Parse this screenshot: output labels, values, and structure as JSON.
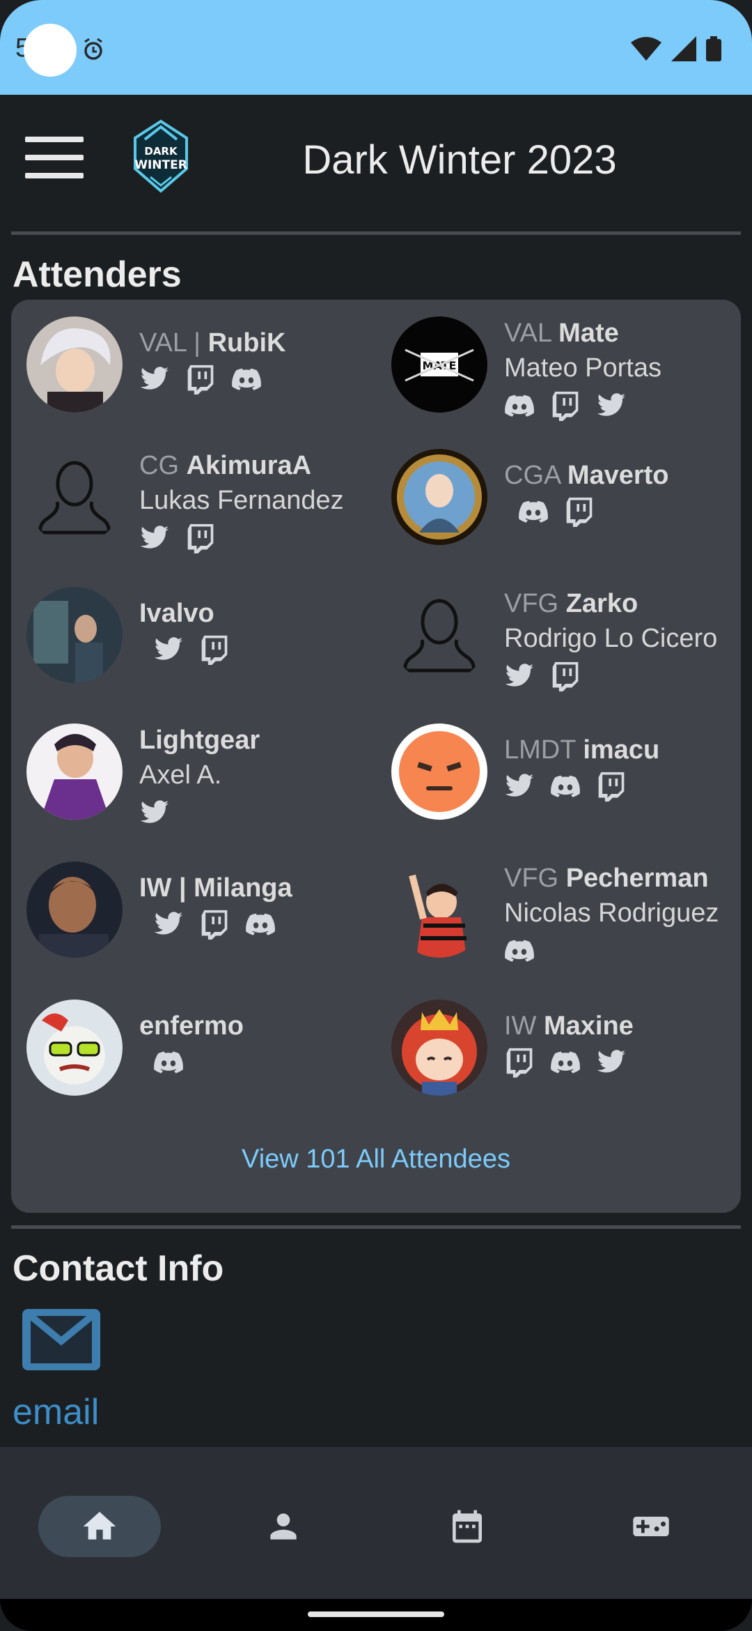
{
  "status_bar": {
    "time_fragment": "5"
  },
  "app_bar": {
    "title": "Dark Winter 2023",
    "logo_text": "DARK WINTER"
  },
  "attenders": {
    "title": "Attenders",
    "view_all": "View 101 All Attendees",
    "items": [
      {
        "prefix": "VAL | ",
        "nick": "RubiK",
        "real": "",
        "socials": [
          "twitter",
          "twitch",
          "discord"
        ]
      },
      {
        "prefix": "VAL ",
        "nick": "Mate",
        "real": "Mateo Portas",
        "socials": [
          "discord",
          "twitch",
          "twitter"
        ]
      },
      {
        "prefix": "CG ",
        "nick": "AkimuraA",
        "real": "Lukas Fernandez",
        "socials": [
          "twitter",
          "twitch"
        ]
      },
      {
        "prefix": "CGA ",
        "nick": "Maverto",
        "real": "",
        "socials": [
          "discord",
          "twitch"
        ]
      },
      {
        "prefix": "",
        "nick": "Ivalvo",
        "real": "",
        "socials": [
          "twitter",
          "twitch"
        ]
      },
      {
        "prefix": "VFG ",
        "nick": "Zarko",
        "real": "Rodrigo Lo Cicero",
        "socials": [
          "twitter",
          "twitch"
        ]
      },
      {
        "prefix": "",
        "nick": "Lightgear",
        "real": "Axel A.",
        "socials": [
          "twitter"
        ]
      },
      {
        "prefix": "LMDT ",
        "nick": "imacu",
        "real": "",
        "socials": [
          "twitter",
          "discord",
          "twitch"
        ]
      },
      {
        "prefix": "",
        "nick": "IW | Milanga",
        "real": "",
        "socials": [
          "twitter",
          "twitch",
          "discord"
        ]
      },
      {
        "prefix": "VFG ",
        "nick": "Pecherman",
        "real": "Nicolas Rodriguez",
        "socials": [
          "discord"
        ]
      },
      {
        "prefix": "",
        "nick": "enfermo",
        "real": "",
        "socials": [
          "discord"
        ]
      },
      {
        "prefix": "IW ",
        "nick": "Maxine",
        "real": "",
        "socials": [
          "twitch",
          "discord",
          "twitter"
        ]
      }
    ]
  },
  "contact": {
    "title": "Contact Info",
    "email_label": "email"
  },
  "nav": {
    "items": [
      "home-icon",
      "person-icon",
      "calendar-icon",
      "gamepad-icon"
    ],
    "active": "home-icon"
  },
  "colors": {
    "accent": "#7ccbfb",
    "card": "#40444a",
    "background": "#1c1f22",
    "link": "#3d8ec9"
  }
}
